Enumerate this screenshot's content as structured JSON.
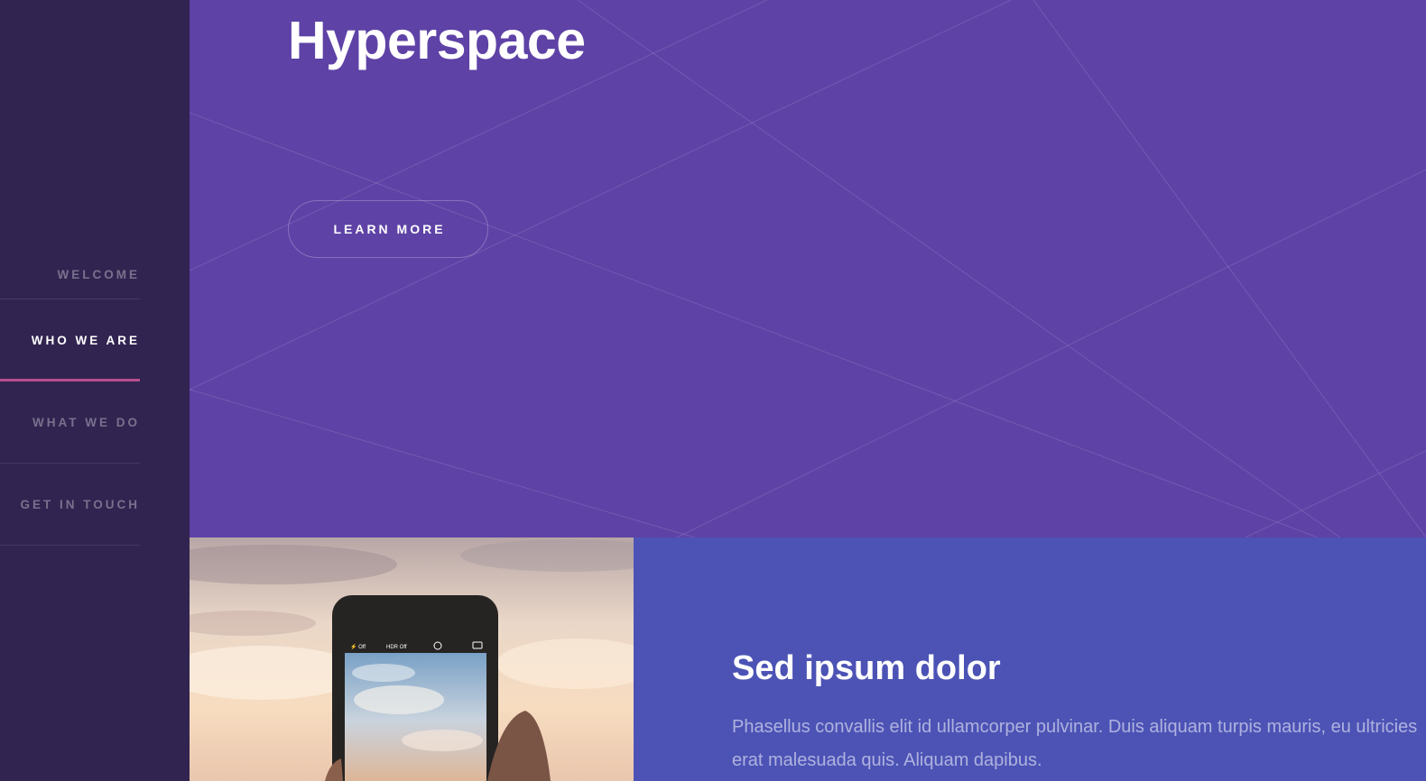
{
  "sidebar": {
    "items": [
      {
        "label": "WELCOME",
        "active": false
      },
      {
        "label": "WHO WE ARE",
        "active": true
      },
      {
        "label": "WHAT WE DO",
        "active": false
      },
      {
        "label": "GET IN TOUCH",
        "active": false
      }
    ]
  },
  "hero": {
    "title": "Hyperspace",
    "button_label": "LEARN MORE"
  },
  "feature": {
    "image_icon": "phone-photo-image",
    "title": "Sed ipsum dolor",
    "text": "Phasellus convallis elit id ullamcorper pulvinar. Duis aliquam turpis mauris, eu ultricies erat malesuada quis. Aliquam dapibus."
  },
  "colors": {
    "sidebar_bg": "#312450",
    "hero_bg": "#5e42a6",
    "feature_bg": "#4c53b5",
    "active_accent": "#b74e91"
  }
}
